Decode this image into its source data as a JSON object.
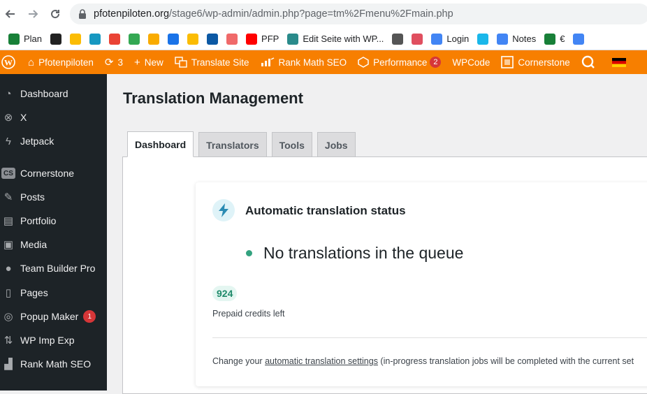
{
  "browser": {
    "url_host": "pfotenpiloten.org",
    "url_path": "/stage6/wp-admin/admin.php?page=tm%2Fmenu%2Fmain.php"
  },
  "bookmarks": [
    {
      "label": "Plan",
      "icon": "sheets-icon",
      "color": "#188038"
    },
    {
      "label": "",
      "icon": "isox-icon",
      "color": "#222222"
    },
    {
      "label": "",
      "icon": "drive-icon",
      "color": "#fbbc04"
    },
    {
      "label": "",
      "icon": "salesforce-icon",
      "color": "#1798c1"
    },
    {
      "label": "",
      "icon": "gmail-icon",
      "color": "#ea4335"
    },
    {
      "label": "",
      "icon": "drive-icon",
      "color": "#34a853"
    },
    {
      "label": "",
      "icon": "analytics-icon",
      "color": "#f9ab00"
    },
    {
      "label": "",
      "icon": "calendar-icon",
      "color": "#1a73e8"
    },
    {
      "label": "",
      "icon": "keep-icon",
      "color": "#fbbc04"
    },
    {
      "label": "",
      "icon": "edge-icon",
      "color": "#0c59a4"
    },
    {
      "label": "",
      "icon": "asana-icon",
      "color": "#f06a6a"
    },
    {
      "label": "PFP",
      "icon": "youtube-icon",
      "color": "#ff0000"
    },
    {
      "label": "Edit Seite with WP...",
      "icon": "wp-icon",
      "color": "#2a8b8b"
    },
    {
      "label": "",
      "icon": "circle-icon",
      "color": "#555555"
    },
    {
      "label": "",
      "icon": "puzzle-icon",
      "color": "#e04f5f"
    },
    {
      "label": "Login",
      "icon": "docs-icon",
      "color": "#4285f4"
    },
    {
      "label": "",
      "icon": "vimeo-icon",
      "color": "#1ab7ea"
    },
    {
      "label": "Notes",
      "icon": "docs-icon",
      "color": "#4285f4"
    },
    {
      "label": "€",
      "icon": "sheets-icon",
      "color": "#188038"
    },
    {
      "label": "",
      "icon": "ads-icon",
      "color": "#4285f4"
    }
  ],
  "adminbar": {
    "site_name": "Pfotenpiloten",
    "updates_count": "3",
    "new_label": "New",
    "translate_label": "Translate Site",
    "rankmath_label": "Rank Math SEO",
    "performance_label": "Performance",
    "performance_badge": "2",
    "wpcode_label": "WPCode",
    "cornerstone_label": "Cornerstone"
  },
  "sidebar": {
    "items": [
      {
        "label": "Dashboard",
        "icon": "dashboard-icon"
      },
      {
        "label": "X",
        "icon": "x-circle-icon"
      },
      {
        "label": "Jetpack",
        "icon": "jetpack-icon"
      },
      {
        "label": "Cornerstone",
        "icon": "cs-icon"
      },
      {
        "label": "Posts",
        "icon": "pin-icon"
      },
      {
        "label": "Portfolio",
        "icon": "portfolio-icon"
      },
      {
        "label": "Media",
        "icon": "media-icon"
      },
      {
        "label": "Team Builder Pro",
        "icon": "user-icon"
      },
      {
        "label": "Pages",
        "icon": "pages-icon"
      },
      {
        "label": "Popup Maker",
        "icon": "popup-icon",
        "badge": "1"
      },
      {
        "label": "WP Imp Exp",
        "icon": "import-icon"
      },
      {
        "label": "Rank Math SEO",
        "icon": "rankmath-icon"
      }
    ]
  },
  "main": {
    "title": "Translation Management",
    "tabs": [
      {
        "label": "Dashboard",
        "active": true
      },
      {
        "label": "Translators",
        "active": false
      },
      {
        "label": "Tools",
        "active": false
      },
      {
        "label": "Jobs",
        "active": false
      }
    ],
    "card": {
      "title": "Automatic translation status",
      "queue_status": "No translations in the queue",
      "credits": "924",
      "credits_label": "Prepaid credits left",
      "note_prefix": "Change your ",
      "note_link": "automatic translation settings",
      "note_suffix": " (in-progress translation jobs will be completed with the current set"
    }
  },
  "colors": {
    "adminbar": "#f77f00",
    "sidebar": "#1d2327",
    "status_dot": "#33a27f",
    "credits_badge": "#e4f6f1"
  }
}
